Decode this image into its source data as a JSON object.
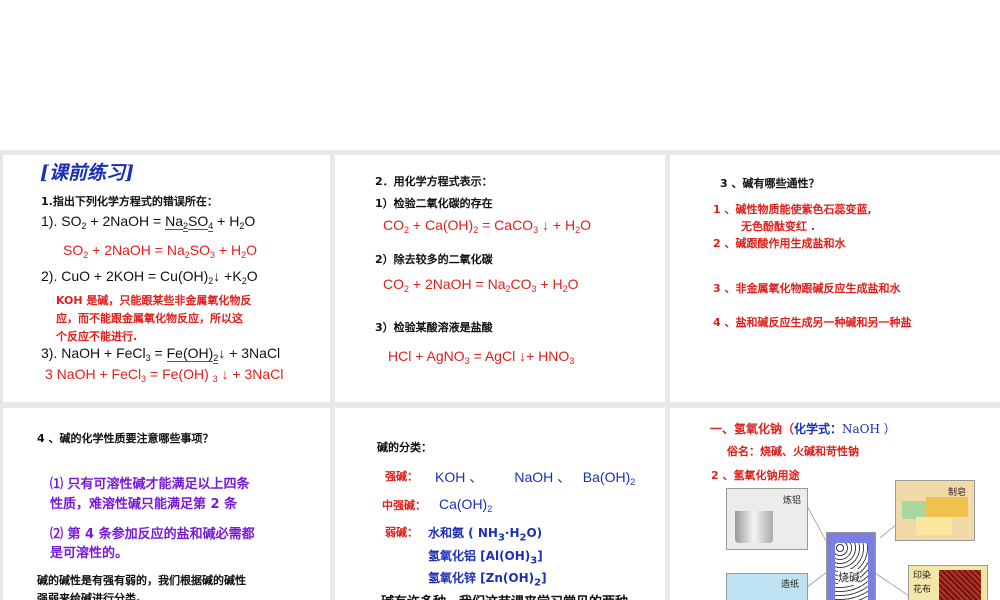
{
  "slides": [
    {
      "title": "[课前练习]",
      "q1": "1.指出下列化学方程式的错误所在：",
      "eq1": [
        [
          "1).  SO"
        ],
        [
          "2",
          "s"
        ],
        [
          " + 2NaOH = "
        ],
        [
          "Na",
          "u"
        ],
        [
          "2",
          "su"
        ],
        [
          "SO",
          "u"
        ],
        [
          "4",
          "su"
        ],
        [
          "  + H"
        ],
        [
          "2",
          "s"
        ],
        [
          "O"
        ]
      ],
      "eq1_fix": [
        [
          "SO"
        ],
        [
          "2",
          "s"
        ],
        [
          " + 2NaOH = Na"
        ],
        [
          "2",
          "s"
        ],
        [
          "SO"
        ],
        [
          "3",
          "s"
        ],
        [
          "  + H"
        ],
        [
          "2",
          "s"
        ],
        [
          "O"
        ]
      ],
      "eq2": [
        [
          "2).  CuO + 2KOH = Cu(OH)"
        ],
        [
          "2",
          "s"
        ],
        [
          "↓ +K"
        ],
        [
          "2",
          "s"
        ],
        [
          "O"
        ]
      ],
      "note": [
        "KOH 是碱，只能跟某些非金属氧化物反",
        "应，而不能跟金属氧化物反应，所以这",
        "个反应不能进行."
      ],
      "eq3": [
        [
          "3).  NaOH + FeCl"
        ],
        [
          "3",
          "s"
        ],
        [
          " = "
        ],
        [
          "Fe(OH)",
          "u"
        ],
        [
          "2",
          "su"
        ],
        [
          "↓ + 3NaCl"
        ]
      ],
      "eq3_fix": [
        [
          "3  NaOH + FeCl"
        ],
        [
          "3",
          "s"
        ],
        [
          " = Fe(OH) "
        ],
        [
          "3",
          "s"
        ],
        [
          " ↓   + 3NaCl"
        ]
      ]
    },
    {
      "title": "2．用化学方程式表示：",
      "s1": "1）检验二氧化碳的存在",
      "e1": [
        [
          "CO"
        ],
        [
          "2",
          "s"
        ],
        [
          " + Ca(OH)"
        ],
        [
          "2",
          "s"
        ],
        [
          " = CaCO"
        ],
        [
          "3",
          "s"
        ],
        [
          " ↓ + H"
        ],
        [
          "2",
          "s"
        ],
        [
          "O"
        ]
      ],
      "s2": "2）除去较多的二氧化碳",
      "e2": [
        [
          "CO"
        ],
        [
          "2",
          "s"
        ],
        [
          " + 2NaOH = Na"
        ],
        [
          "2",
          "s"
        ],
        [
          "CO"
        ],
        [
          "3",
          "s"
        ],
        [
          "  + H"
        ],
        [
          "2",
          "s"
        ],
        [
          "O"
        ]
      ],
      "s3": "3）检验某酸溶液是盐酸",
      "e3": [
        [
          "HCl + AgNO"
        ],
        [
          "3",
          "s"
        ],
        [
          " = AgCl ↓+ HNO"
        ],
        [
          "3",
          "s"
        ]
      ]
    },
    {
      "title": "3 、碱有哪些通性？",
      "items": [
        "1 、碱性物质能使紫色石蕊变蓝,",
        "无色酚酞变红 .",
        "2 、碱跟酸作用生成盐和水",
        "3 、非金属氧化物跟碱反应生成盐和水",
        "4 、盐和碱反应生成另一种碱和另一种盐"
      ]
    },
    {
      "title": "4 、碱的化学性质要注意哪些事项？",
      "points": [
        "⑴ 只有可溶性碱才能满足以上四条",
        "性质，难溶性碱只能满足第 2 条",
        "⑵ 第 4 条参加反应的盐和碱必需都",
        "是可溶性的。"
      ],
      "footer": [
        "碱的碱性是有强有弱的，我们根据碱的碱性",
        "强弱来给碱进行分类。"
      ]
    },
    {
      "title": "碱的分类：",
      "strong_label": "强碱：",
      "strong": [
        [
          "KOH 、        NaOH 、   Ba(OH)"
        ],
        [
          "2",
          "s"
        ]
      ],
      "medium_label": "中强碱：",
      "medium": [
        [
          "Ca(OH)"
        ],
        [
          "2",
          "s"
        ]
      ],
      "weak_label": "弱碱：",
      "weak1": [
        [
          "水和氨 (  NH"
        ],
        [
          "3",
          "s"
        ],
        [
          "·H"
        ],
        [
          "2",
          "s"
        ],
        [
          "O)"
        ]
      ],
      "weak2": [
        [
          "氢氧化铝 [Al(OH)"
        ],
        [
          "3",
          "s"
        ],
        [
          "]"
        ]
      ],
      "weak3": [
        [
          "氢氧化锌 [Zn(OH)"
        ],
        [
          "2",
          "s"
        ],
        [
          "]"
        ]
      ],
      "footer": "碱有许多种，我们这节课来学习常见的两种"
    },
    {
      "title_a": "一、氢氧化钠（",
      "title_b": "化学式：",
      "title_c": "NaOH ）",
      "alias": "俗名：烧碱、火碱和苛性钠",
      "sub": "2 、氢氧化钠用途",
      "labels": {
        "al": "炼铝",
        "soap": "制皂",
        "jar": "烧碱",
        "paper": "造纸",
        "dye": "印染花布"
      }
    }
  ]
}
